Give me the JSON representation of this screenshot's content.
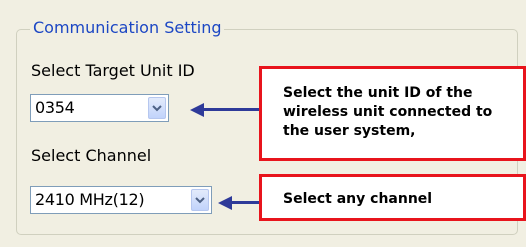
{
  "group": {
    "title": "Communication Setting"
  },
  "target_unit": {
    "label": "Select Target Unit ID",
    "value": "0354"
  },
  "channel": {
    "label": "Select Channel",
    "value": "2410 MHz(12)"
  },
  "callouts": {
    "unit_id": "Select the unit ID of the\nwireless unit connected to\nthe user system,",
    "channel": "Select any channel"
  },
  "icons": {
    "combo_button": "chevron-down-icon",
    "pointer": "arrow-left-icon"
  },
  "colors": {
    "group_title": "#1c47c4",
    "callout_border": "#e8141c",
    "arrow": "#2e3a99",
    "background": "#f1efe2"
  }
}
